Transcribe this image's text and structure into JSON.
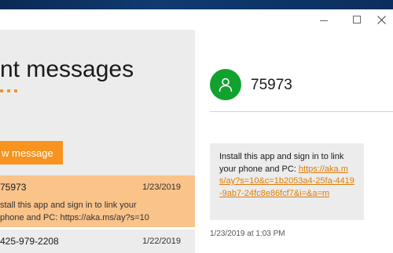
{
  "window": {
    "controls": {
      "minimize_icon": "minimize-icon",
      "maximize_icon": "maximize-icon",
      "close_icon": "close-icon"
    }
  },
  "left": {
    "title": "nt messages",
    "new_message_label": "w message",
    "conversations": [
      {
        "name": "75973",
        "date": "1/23/2019",
        "preview": "stall this app and sign in to link your",
        "preview2": "phone and PC: https://aka.ms/ay?s=10",
        "selected": true
      },
      {
        "name": "425-979-2208",
        "date": "1/22/2019",
        "selected": false
      }
    ]
  },
  "right": {
    "contact_name": "75973",
    "avatar_icon": "person-icon",
    "avatar_color": "#12a12e",
    "message": {
      "text": "Install this app and sign in to link your phone and PC: ",
      "link": "https://aka.ms/ay?s=10&c=1b2053a4-25fa-4419-9ab7-24fc8e86fcf7&i=&a=m"
    },
    "timestamp": "1/23/2019 at 1:03 PM"
  },
  "colors": {
    "accent": "#f7931e",
    "selected_item": "#f9c38a",
    "link": "#e07b00"
  }
}
